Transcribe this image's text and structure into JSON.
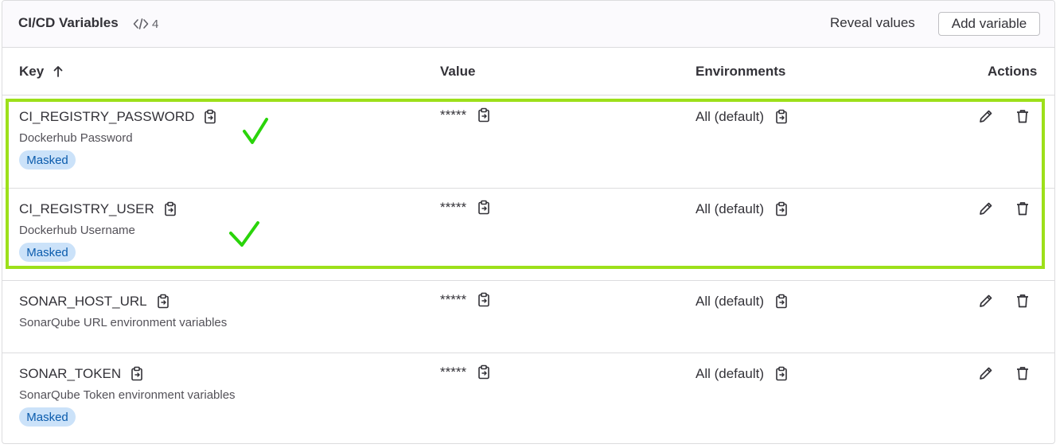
{
  "header": {
    "title": "CI/CD Variables",
    "count": "4",
    "reveal_label": "Reveal values",
    "add_label": "Add variable"
  },
  "columns": {
    "key": "Key",
    "value": "Value",
    "environments": "Environments",
    "actions": "Actions",
    "sort_icon": "arrow-up-icon"
  },
  "rows": [
    {
      "key": "CI_REGISTRY_PASSWORD",
      "description": "Dockerhub Password",
      "badge": "Masked",
      "value": "*****",
      "environment": "All (default)"
    },
    {
      "key": "CI_REGISTRY_USER",
      "description": "Dockerhub Username",
      "badge": "Masked",
      "value": "*****",
      "environment": "All (default)"
    },
    {
      "key": "SONAR_HOST_URL",
      "description": "SonarQube URL environment variables",
      "badge": "",
      "value": "*****",
      "environment": "All (default)"
    },
    {
      "key": "SONAR_TOKEN",
      "description": "SonarQube Token environment variables",
      "badge": "Masked",
      "value": "*****",
      "environment": "All (default)"
    }
  ],
  "annotation": {
    "highlight_color": "#9de01a",
    "check_color": "#2ad40a"
  },
  "colors": {
    "badge_bg": "#cbe2f9",
    "badge_text": "#0b5cad",
    "border": "#dcdcde"
  }
}
